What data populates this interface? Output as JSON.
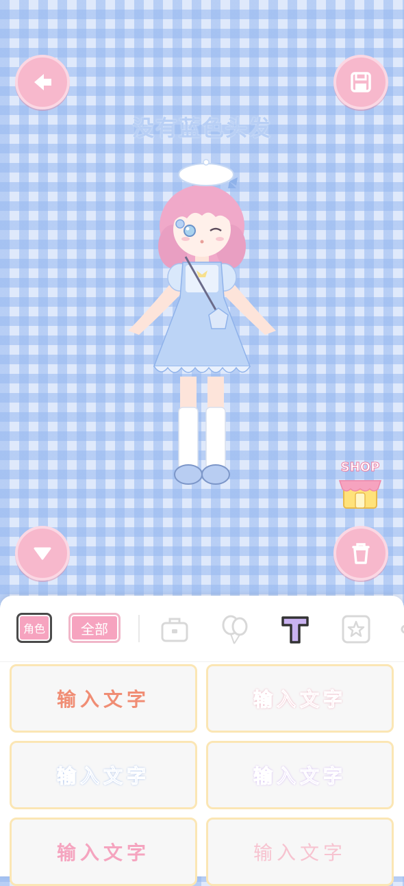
{
  "canvas": {
    "text": "没有蓝色头发",
    "shop_label": "SHOP"
  },
  "toolbar": {
    "back_icon": "back-arrow-icon",
    "save_icon": "save-disk-icon",
    "collapse_icon": "triangle-down-icon",
    "delete_icon": "trash-icon"
  },
  "tabs": {
    "role_label": "角色",
    "all_label": "全部",
    "icons": [
      "bag-icon",
      "balloon-icon",
      "text-t-icon",
      "star-icon",
      "more-icon"
    ],
    "active": "text-t-icon"
  },
  "text_styles": [
    {
      "label": "输入文字"
    },
    {
      "label": "输入文字"
    },
    {
      "label": "输入文字"
    },
    {
      "label": "输入文字"
    },
    {
      "label": "输入文字"
    },
    {
      "label": "输入文字"
    }
  ],
  "colors": {
    "accent_pink": "#f7b8cc",
    "card_border": "#fbe6b4",
    "active_tab": "#b79be8"
  }
}
